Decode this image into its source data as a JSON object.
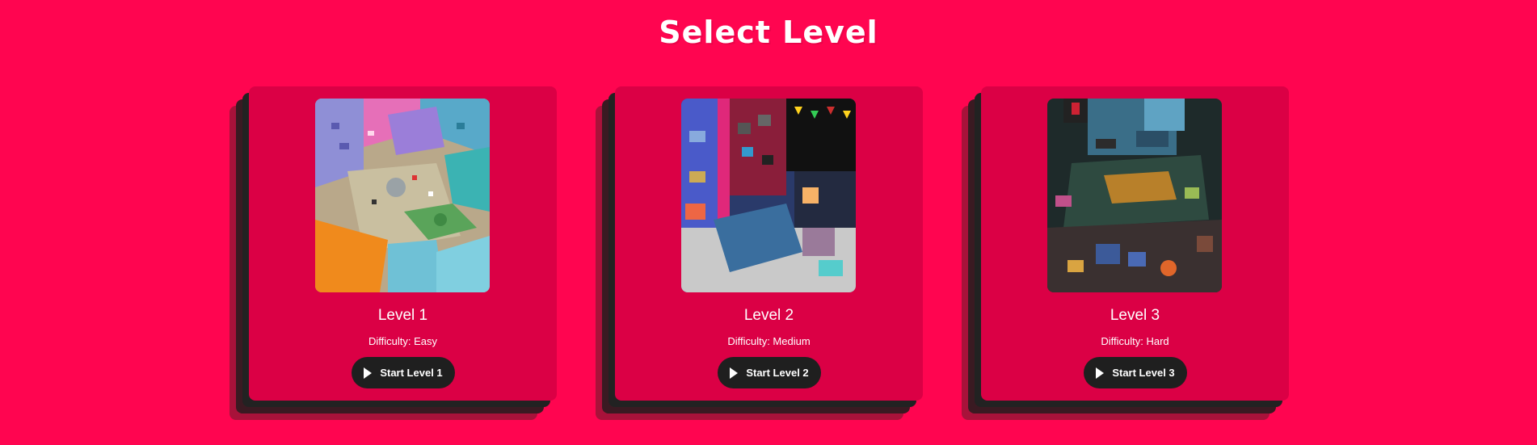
{
  "page": {
    "title": "Select Level"
  },
  "levels": [
    {
      "title": "Level 1",
      "difficulty": "Difficulty: Easy",
      "button_label": "Start Level 1",
      "button_icon": "play-icon"
    },
    {
      "title": "Level 2",
      "difficulty": "Difficulty: Medium",
      "button_label": "Start Level 2",
      "button_icon": "play-icon"
    },
    {
      "title": "Level 3",
      "difficulty": "Difficulty: Hard",
      "button_label": "Start Level 3",
      "button_icon": "play-icon"
    }
  ],
  "colors": {
    "background": "#FF0550",
    "card": "#DB0045",
    "button": "#1f1f1f",
    "text": "#ffffff"
  }
}
